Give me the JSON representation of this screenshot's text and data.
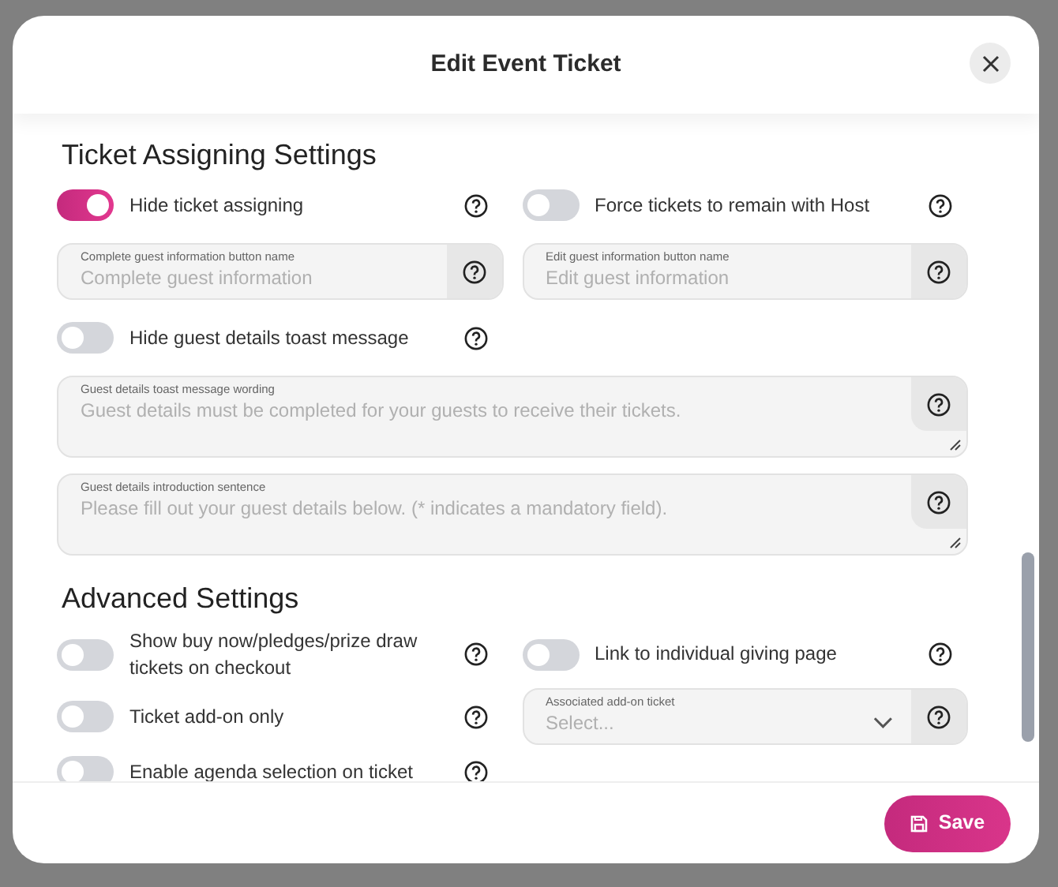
{
  "modal": {
    "title": "Edit Event Ticket"
  },
  "sections": [
    {
      "heading": "Ticket Assigning Settings",
      "items": [
        {
          "kind": "toggle",
          "label": "Hide ticket assigning",
          "on": true
        },
        {
          "kind": "toggle",
          "label": "Force tickets to remain with Host",
          "on": false
        },
        {
          "kind": "input",
          "label": "Complete guest information button name",
          "placeholder": "Complete guest information"
        },
        {
          "kind": "input",
          "label": "Edit guest information button name",
          "placeholder": "Edit guest information"
        },
        {
          "kind": "toggle",
          "label": "Hide guest details toast message",
          "on": false
        },
        {
          "kind": "textarea",
          "label": "Guest details toast message wording",
          "placeholder": "Guest details must be completed for your guests to receive their tickets."
        },
        {
          "kind": "textarea",
          "label": "Guest details introduction sentence",
          "placeholder": "Please fill out your guest details below. (* indicates a mandatory field)."
        }
      ]
    },
    {
      "heading": "Advanced Settings",
      "items": [
        {
          "kind": "toggle",
          "label": "Show buy now/pledges/prize draw tickets on checkout",
          "on": false
        },
        {
          "kind": "toggle",
          "label": "Link to individual giving page",
          "on": false
        },
        {
          "kind": "toggle",
          "label": "Ticket add-on only",
          "on": false
        },
        {
          "kind": "select",
          "label": "Associated add-on ticket",
          "placeholder": "Select..."
        },
        {
          "kind": "toggle",
          "label": "Enable agenda selection on ticket",
          "on": false
        }
      ]
    }
  ],
  "footer": {
    "save": "Save"
  }
}
